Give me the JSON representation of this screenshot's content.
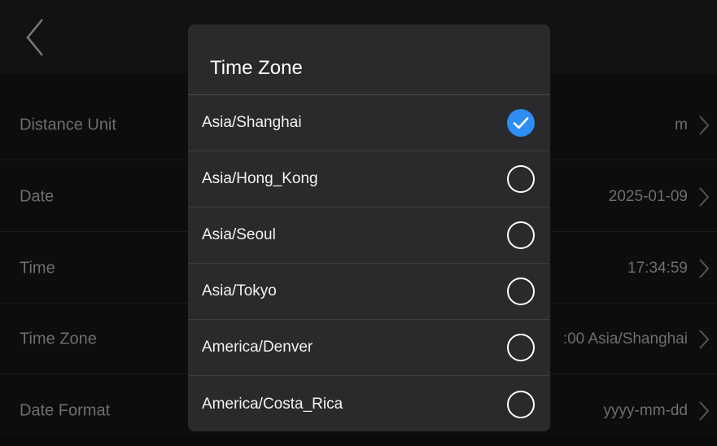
{
  "page": {
    "title": "",
    "rows": [
      {
        "label": "Distance Unit",
        "value": "m"
      },
      {
        "label": "Date",
        "value": "2025-01-09"
      },
      {
        "label": "Time",
        "value": "17:34:59"
      },
      {
        "label": "Time Zone",
        "value": ":00 Asia/Shanghai"
      },
      {
        "label": "Date Format",
        "value": "yyyy-mm-dd"
      }
    ]
  },
  "dialog": {
    "title": "Time Zone",
    "options": [
      {
        "label": "Asia/Shanghai",
        "selected": true
      },
      {
        "label": "Asia/Hong_Kong",
        "selected": false
      },
      {
        "label": "Asia/Seoul",
        "selected": false
      },
      {
        "label": "Asia/Tokyo",
        "selected": false
      },
      {
        "label": "America/Denver",
        "selected": false
      },
      {
        "label": "America/Costa_Rica",
        "selected": false
      }
    ]
  },
  "colors": {
    "accent": "#2e8ef3",
    "dialog_bg": "#2a2a2c",
    "page_bg": "#0d0d0d"
  },
  "icons": {
    "back": "chevron-left-icon",
    "row_arrow": "chevron-right-icon",
    "selected": "check-circle-icon",
    "unselected": "radio-empty-icon"
  }
}
